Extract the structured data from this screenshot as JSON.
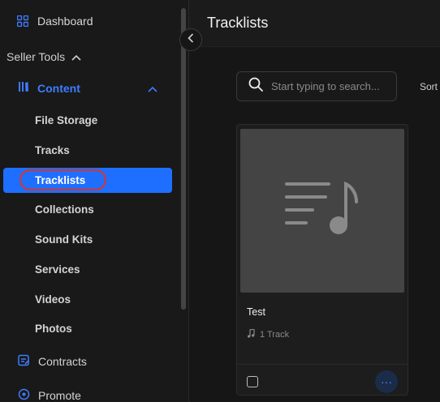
{
  "sidebar": {
    "dashboard_label": "Dashboard",
    "section_label": "Seller Tools",
    "content_label": "Content",
    "items": [
      {
        "label": "File Storage"
      },
      {
        "label": "Tracks"
      },
      {
        "label": "Tracklists"
      },
      {
        "label": "Collections"
      },
      {
        "label": "Sound Kits"
      },
      {
        "label": "Services"
      },
      {
        "label": "Videos"
      },
      {
        "label": "Photos"
      }
    ],
    "active_item": "Tracklists",
    "contracts_label": "Contracts",
    "promote_label": "Promote"
  },
  "main": {
    "title": "Tracklists",
    "search_placeholder": "Start typing to search...",
    "sort_label": "Sort"
  },
  "card": {
    "title": "Test",
    "meta": "1 Track",
    "more_glyph": "···"
  },
  "colors": {
    "accent": "#1e6fff",
    "highlight_ring": "#d9342b",
    "background": "#161616"
  },
  "icons": [
    "grid-icon",
    "chevron-up-icon",
    "library-icon",
    "chevron-left-icon",
    "search-icon",
    "playlist-icon",
    "music-note-icon",
    "contract-icon",
    "promote-icon",
    "more-icon"
  ]
}
